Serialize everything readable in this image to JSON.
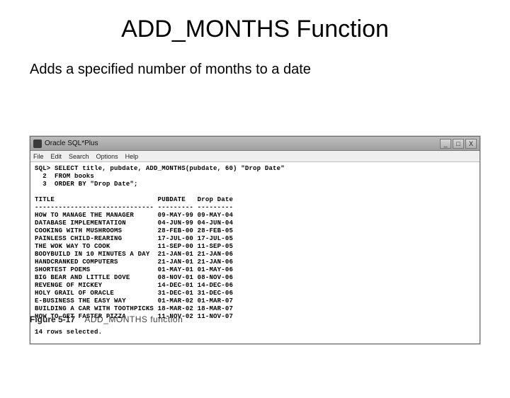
{
  "slide": {
    "title": "ADD_MONTHS Function",
    "description": "Adds a specified number of months to a date"
  },
  "window": {
    "title": "Oracle SQL*Plus",
    "btn_min": "_",
    "btn_max": "□",
    "btn_close": "X"
  },
  "menubar": {
    "file": "File",
    "edit": "Edit",
    "search": "Search",
    "options": "Options",
    "help": "Help"
  },
  "sql": {
    "prompt": "SQL>",
    "l1": "SQL> SELECT title, pubdate, ADD_MONTHS(pubdate, 60) \"Drop Date\"",
    "l2": "  2  FROM books",
    "l3": "  3  ORDER BY \"Drop Date\";",
    "hdr_title": "TITLE",
    "hdr_pubdate": "PUBDATE",
    "hdr_dropdate": "Drop Date",
    "rule_title": "------------------------------",
    "rule_date": "---------",
    "rows": [
      {
        "t": "HOW TO MANAGE THE MANAGER",
        "p": "09-MAY-99",
        "d": "09-MAY-04"
      },
      {
        "t": "DATABASE IMPLEMENTATION",
        "p": "04-JUN-99",
        "d": "04-JUN-04"
      },
      {
        "t": "COOKING WITH MUSHROOMS",
        "p": "28-FEB-00",
        "d": "28-FEB-05"
      },
      {
        "t": "PAINLESS CHILD-REARING",
        "p": "17-JUL-00",
        "d": "17-JUL-05"
      },
      {
        "t": "THE WOK WAY TO COOK",
        "p": "11-SEP-00",
        "d": "11-SEP-05"
      },
      {
        "t": "BODYBUILD IN 10 MINUTES A DAY",
        "p": "21-JAN-01",
        "d": "21-JAN-06"
      },
      {
        "t": "HANDCRANKED COMPUTERS",
        "p": "21-JAN-01",
        "d": "21-JAN-06"
      },
      {
        "t": "SHORTEST POEMS",
        "p": "01-MAY-01",
        "d": "01-MAY-06"
      },
      {
        "t": "BIG BEAR AND LITTLE DOVE",
        "p": "08-NOV-01",
        "d": "08-NOV-06"
      },
      {
        "t": "REVENGE OF MICKEY",
        "p": "14-DEC-01",
        "d": "14-DEC-06"
      },
      {
        "t": "HOLY GRAIL OF ORACLE",
        "p": "31-DEC-01",
        "d": "31-DEC-06"
      },
      {
        "t": "E-BUSINESS THE EASY WAY",
        "p": "01-MAR-02",
        "d": "01-MAR-07"
      },
      {
        "t": "BUILDING A CAR WITH TOOTHPICKS",
        "p": "18-MAR-02",
        "d": "18-MAR-07"
      },
      {
        "t": "HOW TO GET FASTER PIZZA",
        "p": "11-NOV-02",
        "d": "11-NOV-07"
      }
    ],
    "summary": "14 rows selected."
  },
  "figure": {
    "num": "Figure 5-17",
    "text": "ADD_MONTHS function"
  }
}
